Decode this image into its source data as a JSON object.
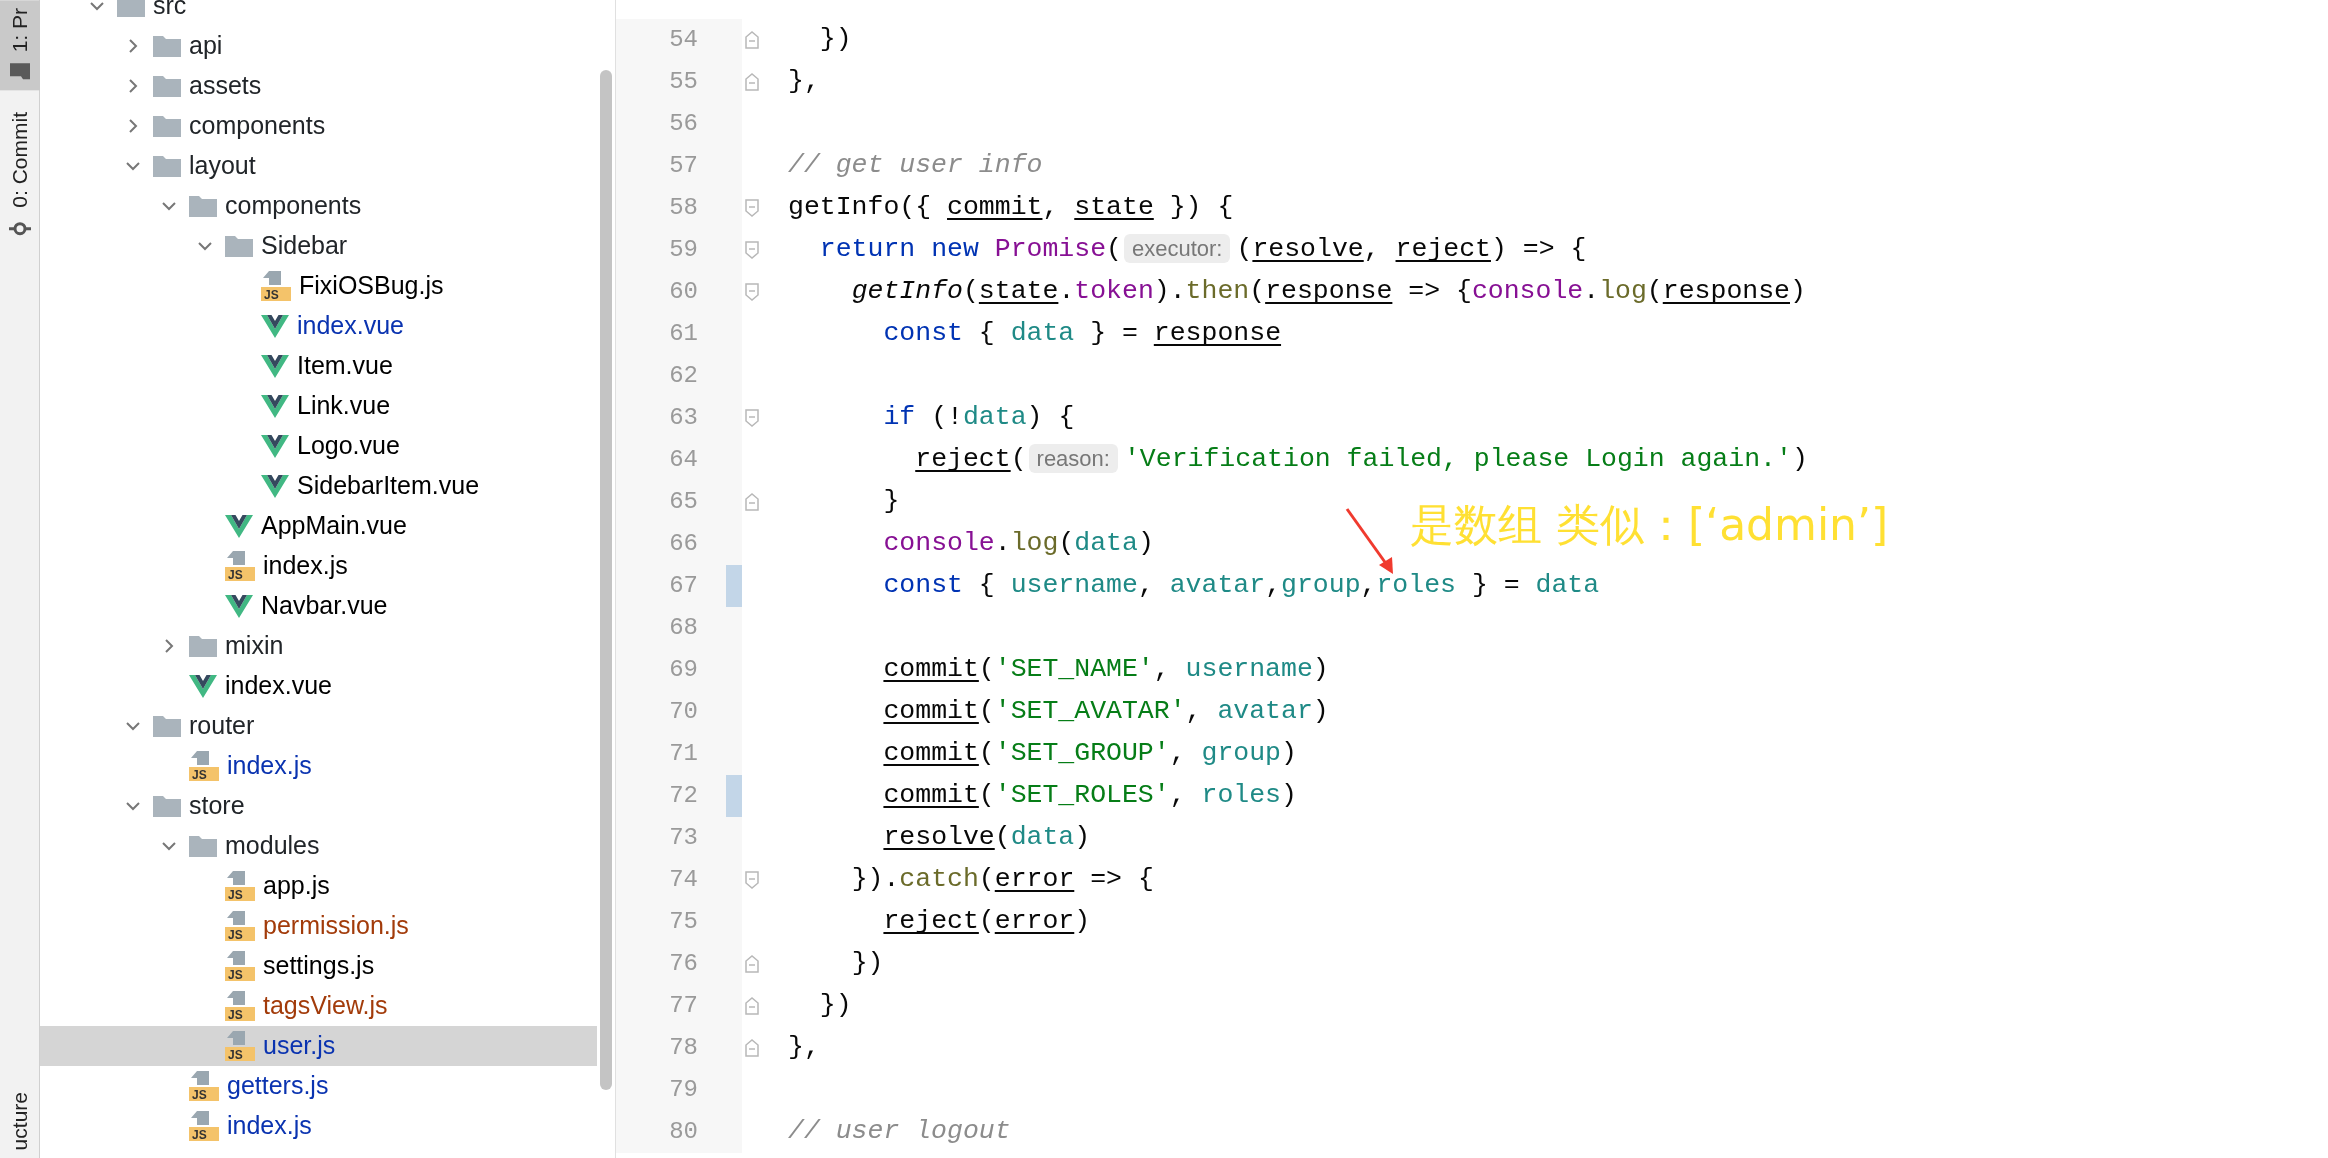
{
  "tool_tabs": [
    {
      "label": "1: Pr",
      "kind": "project",
      "selected": true
    },
    {
      "label": "0: Commit",
      "kind": "commit",
      "selected": false
    }
  ],
  "bottom_tabs": [
    {
      "label": "ucture"
    }
  ],
  "project_tree": [
    {
      "name": "src",
      "kind": "folder",
      "expanded": true,
      "selected": false,
      "children": [
        {
          "name": "api",
          "kind": "folder",
          "expanded": false,
          "selected": false
        },
        {
          "name": "assets",
          "kind": "folder",
          "expanded": false,
          "selected": false
        },
        {
          "name": "components",
          "kind": "folder",
          "expanded": false,
          "selected": false
        },
        {
          "name": "layout",
          "kind": "folder",
          "expanded": true,
          "selected": false,
          "children": [
            {
              "name": "components",
              "kind": "folder",
              "expanded": true,
              "selected": false,
              "children": [
                {
                  "name": "Sidebar",
                  "kind": "folder",
                  "expanded": true,
                  "selected": false,
                  "children": [
                    {
                      "name": "FixiOSBug.js",
                      "kind": "js",
                      "icon_text": "JS",
                      "color": "#000000",
                      "selected": false
                    },
                    {
                      "name": "index.vue",
                      "kind": "vue",
                      "color": "#0a33b0",
                      "selected": false
                    },
                    {
                      "name": "Item.vue",
                      "kind": "vue",
                      "color": "#000000",
                      "selected": false
                    },
                    {
                      "name": "Link.vue",
                      "kind": "vue",
                      "color": "#000000",
                      "selected": false
                    },
                    {
                      "name": "Logo.vue",
                      "kind": "vue",
                      "color": "#000000",
                      "selected": false
                    },
                    {
                      "name": "SidebarItem.vue",
                      "kind": "vue",
                      "color": "#000000",
                      "selected": false
                    }
                  ]
                },
                {
                  "name": "AppMain.vue",
                  "kind": "vue",
                  "color": "#000000",
                  "selected": false
                },
                {
                  "name": "index.js",
                  "kind": "js",
                  "icon_text": "JS",
                  "color": "#000000",
                  "selected": false
                },
                {
                  "name": "Navbar.vue",
                  "kind": "vue",
                  "color": "#000000",
                  "selected": false
                }
              ]
            },
            {
              "name": "mixin",
              "kind": "folder",
              "expanded": false,
              "selected": false
            },
            {
              "name": "index.vue",
              "kind": "vue",
              "color": "#000000",
              "selected": false
            }
          ]
        },
        {
          "name": "router",
          "kind": "folder",
          "expanded": true,
          "selected": false,
          "children": [
            {
              "name": "index.js",
              "kind": "js",
              "icon_text": "JS",
              "color": "#0a33b0",
              "selected": false
            }
          ]
        },
        {
          "name": "store",
          "kind": "folder",
          "expanded": true,
          "selected": false,
          "children": [
            {
              "name": "modules",
              "kind": "folder",
              "expanded": true,
              "selected": false,
              "children": [
                {
                  "name": "app.js",
                  "kind": "js",
                  "icon_text": "JS",
                  "color": "#000000",
                  "selected": false
                },
                {
                  "name": "permission.js",
                  "kind": "js",
                  "icon_text": "JS",
                  "color": "#a23b0a",
                  "selected": false
                },
                {
                  "name": "settings.js",
                  "kind": "js",
                  "icon_text": "JS",
                  "color": "#000000",
                  "selected": false
                },
                {
                  "name": "tagsView.js",
                  "kind": "js",
                  "icon_text": "JS",
                  "color": "#a23b0a",
                  "selected": false
                },
                {
                  "name": "user.js",
                  "kind": "js",
                  "icon_text": "JS",
                  "color": "#0a33b0",
                  "selected": true
                }
              ]
            },
            {
              "name": "getters.js",
              "kind": "js",
              "icon_text": "JS",
              "color": "#0a33b0",
              "selected": false
            },
            {
              "name": "index.js",
              "kind": "js",
              "icon_text": "JS",
              "color": "#0a33b0",
              "selected": false
            }
          ]
        }
      ]
    }
  ],
  "editor": {
    "lines": [
      {
        "number": "54",
        "changed": false,
        "kind": "fold_end",
        "tokens": [
          {
            "kind": "plain",
            "text": "  })"
          }
        ]
      },
      {
        "number": "55",
        "changed": false,
        "kind": "fold_end",
        "tokens": [
          {
            "kind": "plain",
            "text": "},"
          }
        ]
      },
      {
        "number": "56",
        "changed": false,
        "kind": "plain"
      },
      {
        "number": "57",
        "changed": false,
        "kind": "plain",
        "tokens": [
          {
            "kind": "comment",
            "text": "// get user info"
          }
        ]
      },
      {
        "number": "58",
        "changed": false,
        "kind": "fold_start",
        "tokens": [
          {
            "kind": "plain",
            "text": "getInfo({ "
          },
          {
            "kind": "param",
            "text": "commit"
          },
          {
            "kind": "plain",
            "text": ", "
          },
          {
            "kind": "param",
            "text": "state"
          },
          {
            "kind": "plain",
            "text": " }) {"
          }
        ]
      },
      {
        "number": "59",
        "changed": false,
        "kind": "fold_start",
        "tokens": [
          {
            "kind": "keyword",
            "text": "  return new "
          },
          {
            "kind": "global",
            "text": "Promise"
          },
          {
            "kind": "plain",
            "text": "("
          },
          {
            "kind": "hint",
            "text": "executor:"
          },
          {
            "kind": "plain",
            "text": "("
          },
          {
            "kind": "param",
            "text": "resolve"
          },
          {
            "kind": "plain",
            "text": ", "
          },
          {
            "kind": "param",
            "text": "reject"
          },
          {
            "kind": "plain",
            "text": ") => {"
          }
        ]
      },
      {
        "number": "60",
        "changed": false,
        "kind": "fold_start",
        "tokens": [
          {
            "kind": "italic",
            "text": "    getInfo"
          },
          {
            "kind": "plain",
            "text": "("
          },
          {
            "kind": "param",
            "text": "state"
          },
          {
            "kind": "plain",
            "text": "."
          },
          {
            "kind": "global",
            "text": "token"
          },
          {
            "kind": "plain",
            "text": ")."
          },
          {
            "kind": "method",
            "text": "then"
          },
          {
            "kind": "plain",
            "text": "("
          },
          {
            "kind": "param",
            "text": "response"
          },
          {
            "kind": "plain",
            "text": " => {"
          },
          {
            "kind": "global",
            "text": "console"
          },
          {
            "kind": "plain",
            "text": "."
          },
          {
            "kind": "method",
            "text": "log"
          },
          {
            "kind": "plain",
            "text": "("
          },
          {
            "kind": "param",
            "text": "response"
          },
          {
            "kind": "plain",
            "text": ")"
          }
        ]
      },
      {
        "number": "61",
        "changed": false,
        "kind": "plain",
        "tokens": [
          {
            "kind": "keyword",
            "text": "      const"
          },
          {
            "kind": "plain",
            "text": " { "
          },
          {
            "kind": "variable",
            "text": "data"
          },
          {
            "kind": "plain",
            "text": " } = "
          },
          {
            "kind": "param",
            "text": "response"
          }
        ]
      },
      {
        "number": "62",
        "changed": false,
        "kind": "plain"
      },
      {
        "number": "63",
        "changed": false,
        "kind": "fold_start",
        "tokens": [
          {
            "kind": "keyword",
            "text": "      if"
          },
          {
            "kind": "plain",
            "text": " (!"
          },
          {
            "kind": "variable",
            "text": "data"
          },
          {
            "kind": "plain",
            "text": ") {"
          }
        ]
      },
      {
        "number": "64",
        "changed": false,
        "kind": "plain",
        "tokens": [
          {
            "kind": "param",
            "text": "        reject"
          },
          {
            "kind": "plain",
            "text": "("
          },
          {
            "kind": "hint",
            "text": "reason:"
          },
          {
            "kind": "string",
            "text": "'Verification failed, please Login again.'"
          },
          {
            "kind": "plain",
            "text": ")"
          }
        ]
      },
      {
        "number": "65",
        "changed": false,
        "kind": "fold_end",
        "tokens": [
          {
            "kind": "plain",
            "text": "      }"
          }
        ]
      },
      {
        "number": "66",
        "changed": false,
        "kind": "plain",
        "tokens": [
          {
            "kind": "global",
            "text": "      console"
          },
          {
            "kind": "plain",
            "text": "."
          },
          {
            "kind": "method",
            "text": "log"
          },
          {
            "kind": "plain",
            "text": "("
          },
          {
            "kind": "variable",
            "text": "data"
          },
          {
            "kind": "plain",
            "text": ")"
          }
        ]
      },
      {
        "number": "67",
        "changed": true,
        "kind": "plain",
        "tokens": [
          {
            "kind": "keyword",
            "text": "      const"
          },
          {
            "kind": "plain",
            "text": " { "
          },
          {
            "kind": "variable",
            "text": "username"
          },
          {
            "kind": "plain",
            "text": ", "
          },
          {
            "kind": "variable",
            "text": "avatar"
          },
          {
            "kind": "plain",
            "text": ","
          },
          {
            "kind": "variable",
            "text": "group"
          },
          {
            "kind": "plain",
            "text": ","
          },
          {
            "kind": "variable",
            "text": "roles"
          },
          {
            "kind": "plain",
            "text": " } = "
          },
          {
            "kind": "variable",
            "text": "data"
          }
        ]
      },
      {
        "number": "68",
        "changed": false,
        "kind": "plain"
      },
      {
        "number": "69",
        "changed": false,
        "kind": "plain",
        "tokens": [
          {
            "kind": "param",
            "text": "      commit"
          },
          {
            "kind": "plain",
            "text": "("
          },
          {
            "kind": "string",
            "text": "'SET_NAME'"
          },
          {
            "kind": "plain",
            "text": ", "
          },
          {
            "kind": "variable",
            "text": "username"
          },
          {
            "kind": "plain",
            "text": ")"
          }
        ]
      },
      {
        "number": "70",
        "changed": false,
        "kind": "plain",
        "tokens": [
          {
            "kind": "param",
            "text": "      commit"
          },
          {
            "kind": "plain",
            "text": "("
          },
          {
            "kind": "string",
            "text": "'SET_AVATAR'"
          },
          {
            "kind": "plain",
            "text": ", "
          },
          {
            "kind": "variable",
            "text": "avatar"
          },
          {
            "kind": "plain",
            "text": ")"
          }
        ]
      },
      {
        "number": "71",
        "changed": false,
        "kind": "plain",
        "tokens": [
          {
            "kind": "param",
            "text": "      commit"
          },
          {
            "kind": "plain",
            "text": "("
          },
          {
            "kind": "string",
            "text": "'SET_GROUP'"
          },
          {
            "kind": "plain",
            "text": ", "
          },
          {
            "kind": "variable",
            "text": "group"
          },
          {
            "kind": "plain",
            "text": ")"
          }
        ]
      },
      {
        "number": "72",
        "changed": true,
        "kind": "plain",
        "tokens": [
          {
            "kind": "param",
            "text": "      commit"
          },
          {
            "kind": "plain",
            "text": "("
          },
          {
            "kind": "string",
            "text": "'SET_ROLES'"
          },
          {
            "kind": "plain",
            "text": ", "
          },
          {
            "kind": "variable",
            "text": "roles"
          },
          {
            "kind": "plain",
            "text": ")"
          }
        ]
      },
      {
        "number": "73",
        "changed": false,
        "kind": "plain",
        "tokens": [
          {
            "kind": "param",
            "text": "      resolve"
          },
          {
            "kind": "plain",
            "text": "("
          },
          {
            "kind": "variable",
            "text": "data"
          },
          {
            "kind": "plain",
            "text": ")"
          }
        ]
      },
      {
        "number": "74",
        "changed": false,
        "kind": "fold_start",
        "tokens": [
          {
            "kind": "plain",
            "text": "    })."
          },
          {
            "kind": "method",
            "text": "catch"
          },
          {
            "kind": "plain",
            "text": "("
          },
          {
            "kind": "param",
            "text": "error"
          },
          {
            "kind": "plain",
            "text": " => {"
          }
        ]
      },
      {
        "number": "75",
        "changed": false,
        "kind": "plain",
        "tokens": [
          {
            "kind": "param",
            "text": "      reject"
          },
          {
            "kind": "plain",
            "text": "("
          },
          {
            "kind": "param",
            "text": "error"
          },
          {
            "kind": "plain",
            "text": ")"
          }
        ]
      },
      {
        "number": "76",
        "changed": false,
        "kind": "fold_end",
        "tokens": [
          {
            "kind": "plain",
            "text": "    })"
          }
        ]
      },
      {
        "number": "77",
        "changed": false,
        "kind": "fold_end",
        "tokens": [
          {
            "kind": "plain",
            "text": "  })"
          }
        ]
      },
      {
        "number": "78",
        "changed": false,
        "kind": "fold_end",
        "tokens": [
          {
            "kind": "plain",
            "text": "},"
          }
        ]
      },
      {
        "number": "79",
        "changed": false,
        "kind": "plain"
      },
      {
        "number": "80",
        "changed": false,
        "kind": "plain",
        "tokens": [
          {
            "kind": "comment",
            "text": "// user logout"
          }
        ]
      }
    ]
  },
  "annotation": {
    "text": "是数组 类似：[‘admin’]"
  }
}
